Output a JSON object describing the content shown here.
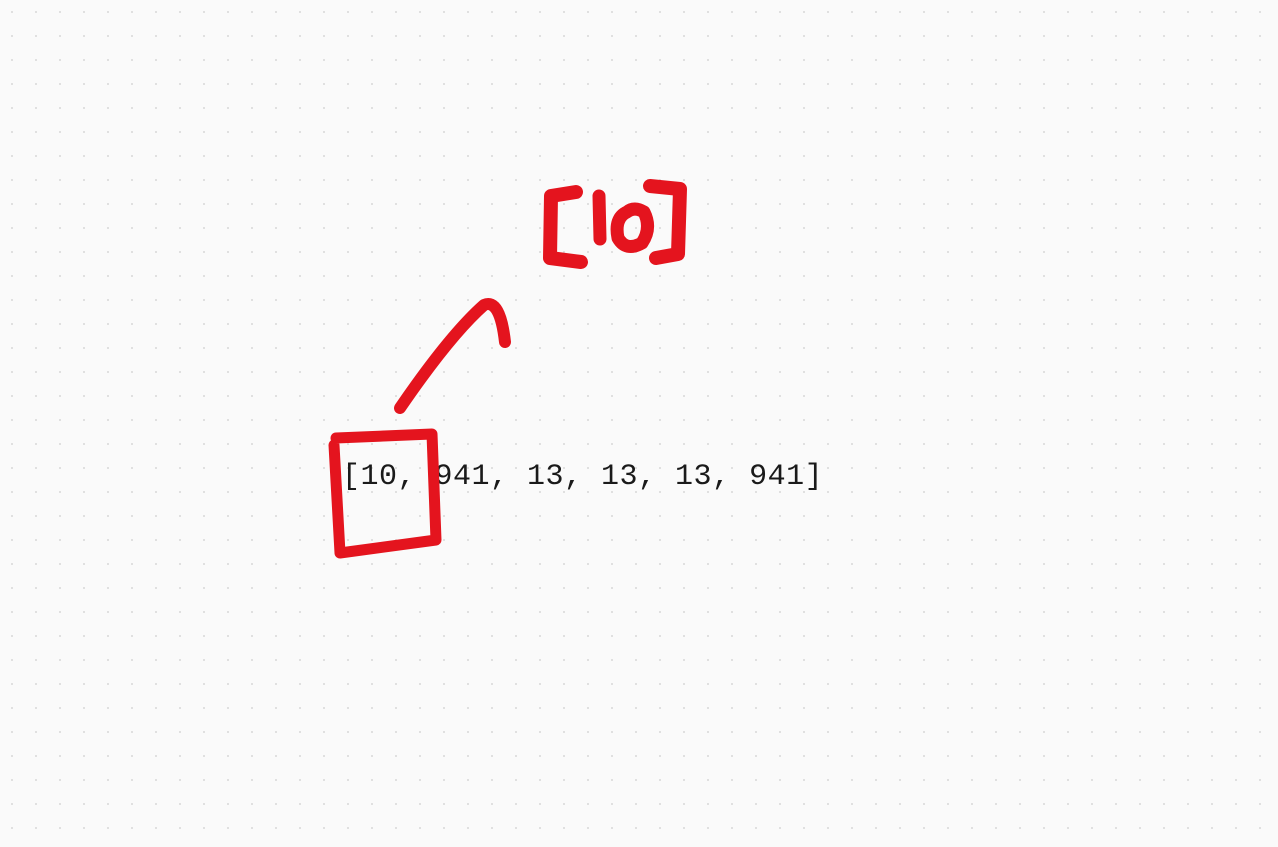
{
  "canvas": {
    "array_text": "[10, 941, 13, 13, 13, 941]",
    "annotation_label": "[10]",
    "annotation_color": "#e4141e"
  }
}
